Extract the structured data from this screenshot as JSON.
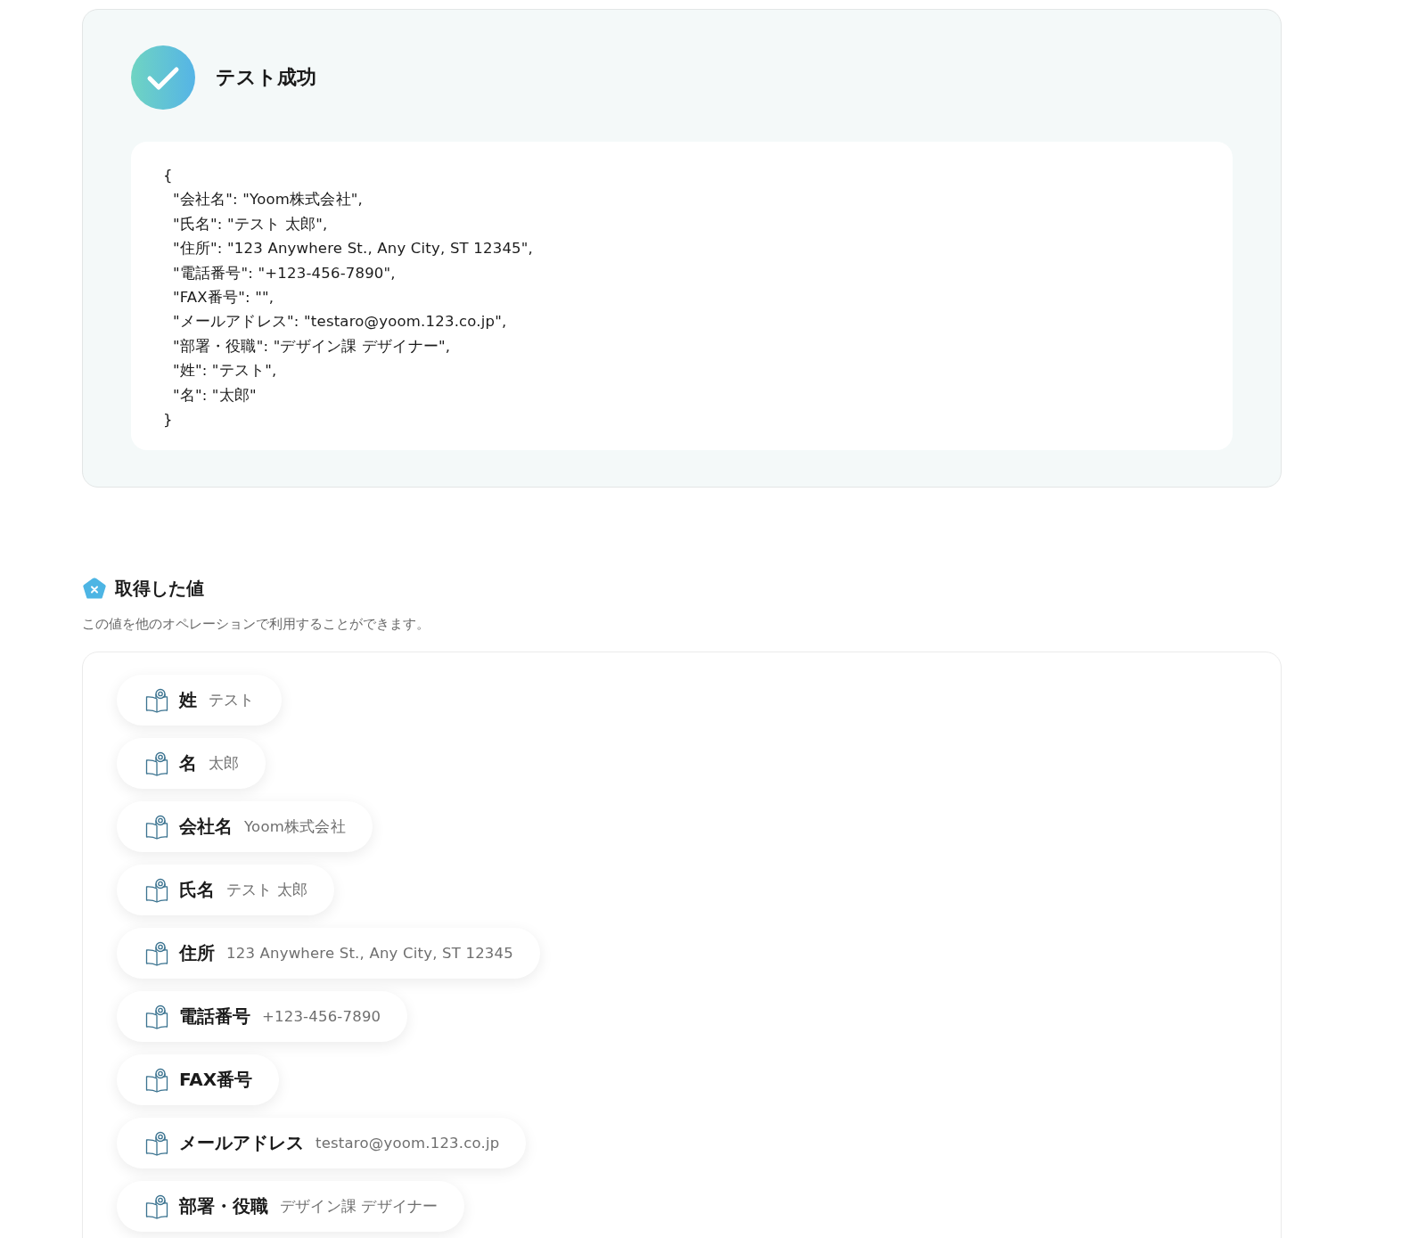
{
  "test_result": {
    "success": true,
    "title": "テスト成功",
    "output_lines": [
      "{",
      "  \"会社名\": \"Yoom株式会社\",",
      "  \"氏名\": \"テスト 太郎\",",
      "  \"住所\": \"123 Anywhere St., Any City, ST 12345\",",
      "  \"電話番号\": \"+123-456-7890\",",
      "  \"FAX番号\": \"\",",
      "  \"メールアドレス\": \"testaro@yoom.123.co.jp\",",
      "  \"部署・役職\": \"デザイン課 デザイナー\",",
      "  \"姓\": \"テスト\",",
      "  \"名\": \"太郎\"",
      "}"
    ]
  },
  "extracted_values": {
    "title": "取得した値",
    "description": "この値を他のオペレーションで利用することができます。",
    "items": [
      {
        "label": "姓",
        "value": "テスト"
      },
      {
        "label": "名",
        "value": "太郎"
      },
      {
        "label": "会社名",
        "value": "Yoom株式会社"
      },
      {
        "label": "氏名",
        "value": "テスト 太郎"
      },
      {
        "label": "住所",
        "value": "123 Anywhere St., Any City, ST 12345"
      },
      {
        "label": "電話番号",
        "value": "+123-456-7890"
      },
      {
        "label": "FAX番号"
      },
      {
        "label": "メールアドレス",
        "value": "testaro@yoom.123.co.jp"
      },
      {
        "label": "部署・役職",
        "value": "デザイン課 デザイナー"
      }
    ]
  }
}
